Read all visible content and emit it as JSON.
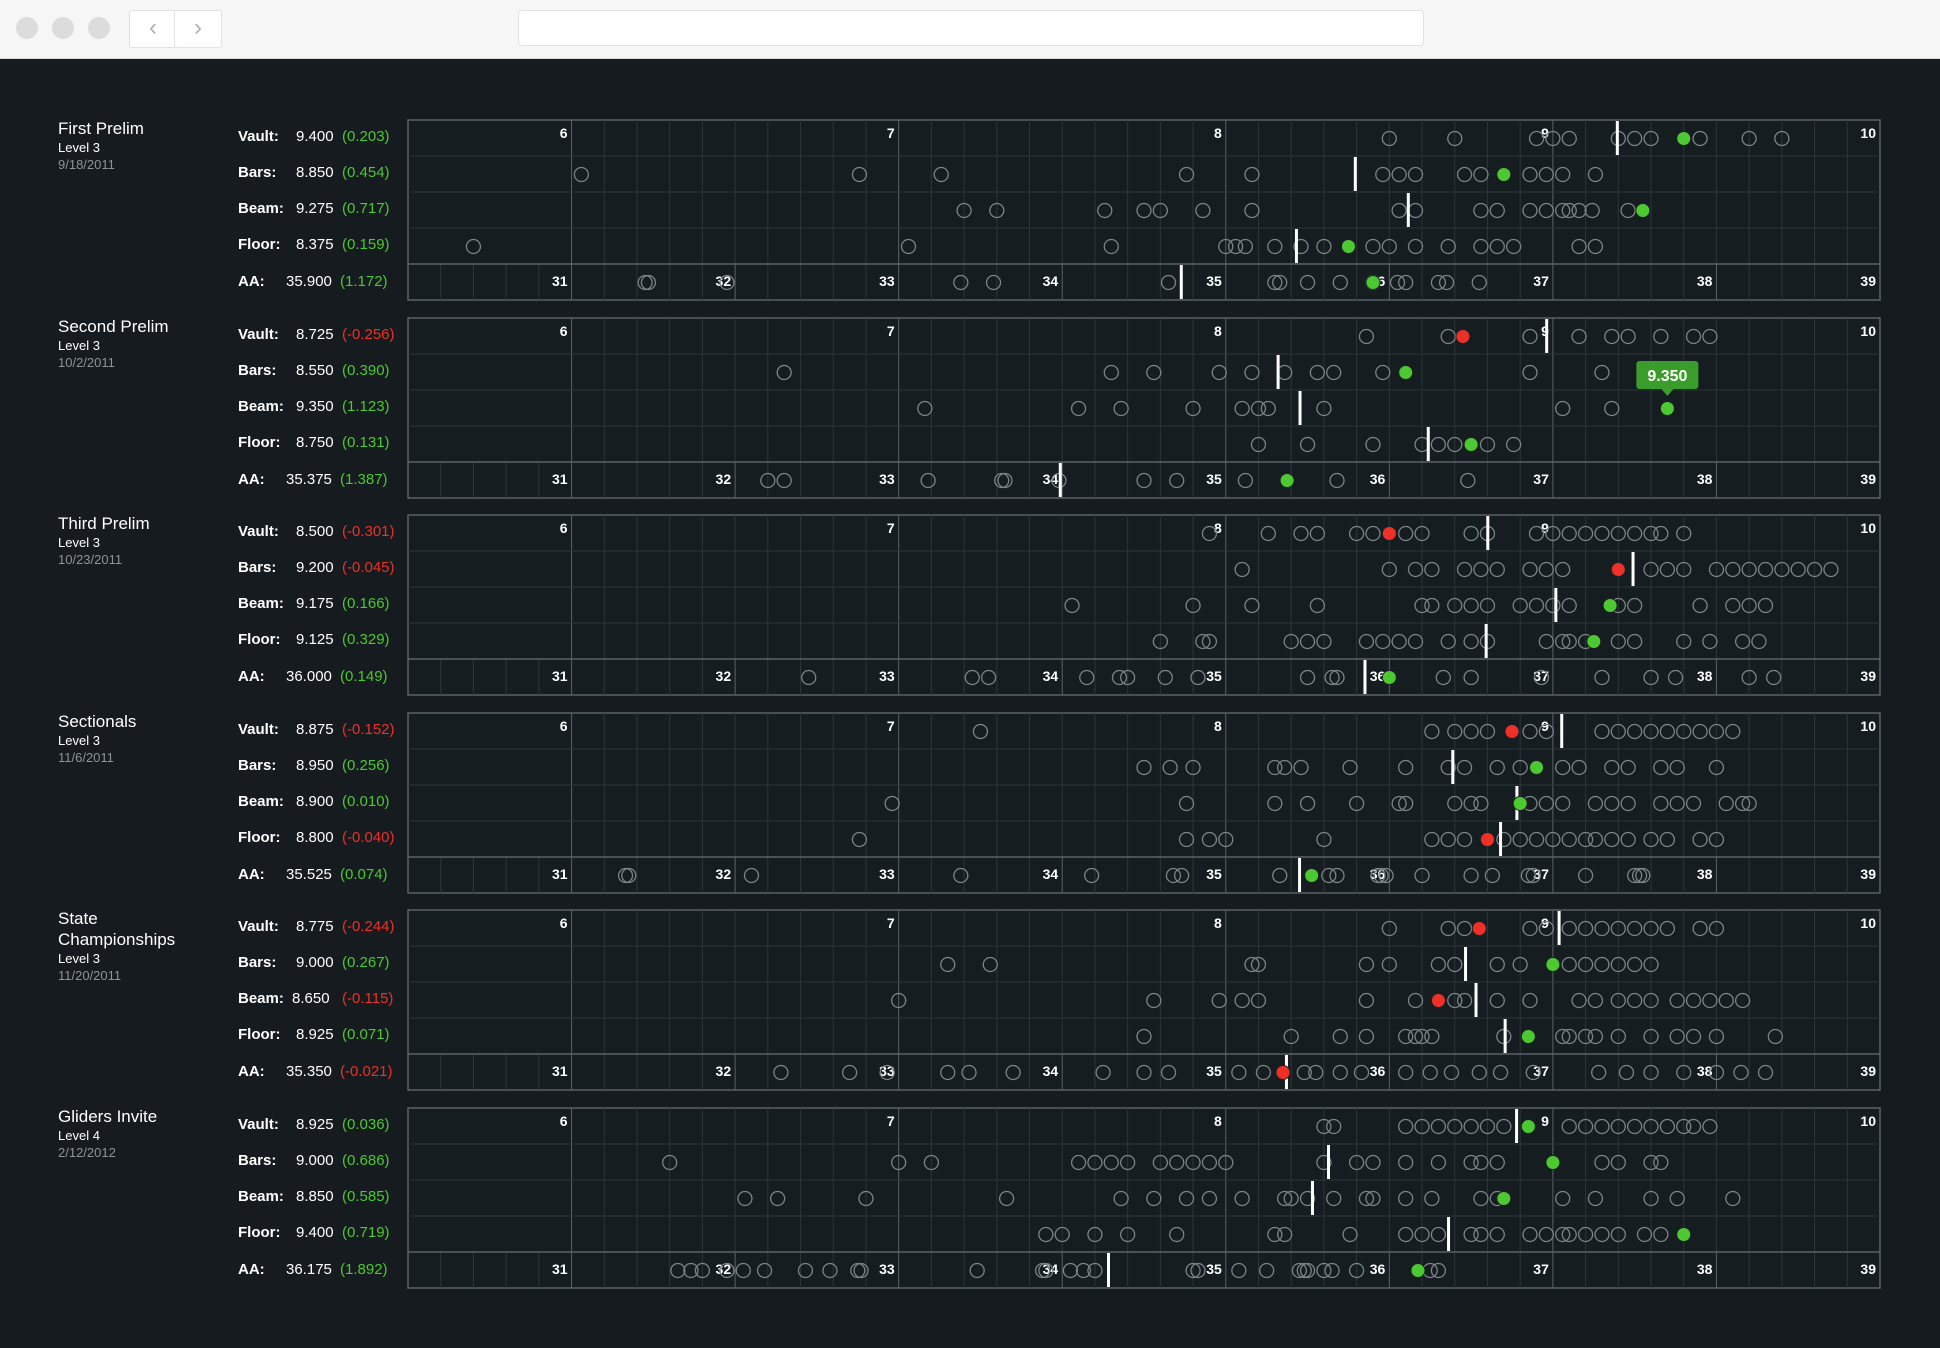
{
  "colors": {
    "background": "#151b1e",
    "grid": "#3b4246",
    "ring": "#7d8488",
    "positive": "#4cc831",
    "negative": "#ee3028",
    "text": "#ffffff",
    "date": "#8e9396",
    "tooltip": "#3a9c2b"
  },
  "chart_data": {
    "type": "scatter",
    "title": "",
    "events": [
      "Vault:",
      "Bars:",
      "Beam:",
      "Floor:",
      "AA:"
    ],
    "event_axis": {
      "min": 5.5,
      "max": 10,
      "ticks": [
        6,
        7,
        8,
        9,
        10
      ]
    },
    "aa_axis": {
      "min": 30,
      "max": 39,
      "ticks": [
        31,
        32,
        33,
        34,
        35,
        36,
        37,
        38,
        39
      ]
    },
    "tooltip": {
      "meet": 1,
      "row": 2,
      "text": "9.350"
    },
    "meets": [
      {
        "name": "First Prelim",
        "level": "Level 3",
        "date": "9/18/2011",
        "rows": [
          {
            "event": "Vault:",
            "score": "9.400",
            "diff": "(0.203)",
            "sign": "pos",
            "value": 9.4,
            "mean": 9.197,
            "field": [
              8.5,
              8.7,
              8.95,
              9.0,
              9.05,
              9.2,
              9.25,
              9.3,
              9.45,
              9.6,
              9.7
            ]
          },
          {
            "event": "Bars:",
            "score": "8.850",
            "diff": "(0.454)",
            "sign": "pos",
            "value": 8.85,
            "mean": 8.396,
            "field": [
              6.03,
              6.88,
              7.13,
              7.88,
              8.08,
              8.48,
              8.53,
              8.58,
              8.73,
              8.78,
              8.93,
              8.98,
              9.03,
              9.13
            ]
          },
          {
            "event": "Beam:",
            "score": "9.275",
            "diff": "(0.717)",
            "sign": "pos",
            "value": 9.275,
            "mean": 8.558,
            "field": [
              7.2,
              7.3,
              7.63,
              7.75,
              7.8,
              7.93,
              8.08,
              8.53,
              8.58,
              8.78,
              8.83,
              8.93,
              8.98,
              9.03,
              9.05,
              9.08,
              9.12,
              9.23
            ]
          },
          {
            "event": "Floor:",
            "score": "8.375",
            "diff": "(0.159)",
            "sign": "pos",
            "value": 8.375,
            "mean": 8.216,
            "field": [
              5.7,
              7.03,
              7.65,
              8.0,
              8.03,
              8.06,
              8.15,
              8.23,
              8.3,
              8.45,
              8.5,
              8.58,
              8.68,
              8.78,
              8.83,
              8.88,
              9.08,
              9.13
            ]
          },
          {
            "event": "AA:",
            "score": "35.900",
            "diff": "(1.172)",
            "sign": "pos",
            "value": 35.9,
            "mean": 34.728,
            "field": [
              31.45,
              31.47,
              31.95,
              33.38,
              33.58,
              34.65,
              35.3,
              35.33,
              35.5,
              35.7,
              35.9,
              36.05,
              36.1,
              36.3,
              36.35,
              36.55
            ]
          }
        ]
      },
      {
        "name": "Second Prelim",
        "level": "Level 3",
        "date": "10/2/2011",
        "rows": [
          {
            "event": "Vault:",
            "score": "8.725",
            "diff": "(-0.256)",
            "sign": "neg",
            "value": 8.725,
            "mean": 8.981,
            "field": [
              8.43,
              8.68,
              8.93,
              9.08,
              9.18,
              9.23,
              9.33,
              9.43,
              9.48
            ]
          },
          {
            "event": "Bars:",
            "score": "8.550",
            "diff": "(0.390)",
            "sign": "pos",
            "value": 8.55,
            "mean": 8.16,
            "field": [
              6.65,
              7.65,
              7.78,
              7.98,
              8.08,
              8.18,
              8.28,
              8.33,
              8.48,
              8.93,
              9.15
            ]
          },
          {
            "event": "Beam:",
            "score": "9.350",
            "diff": "(1.123)",
            "sign": "pos",
            "value": 9.35,
            "mean": 8.227,
            "field": [
              7.08,
              7.55,
              7.68,
              7.9,
              8.05,
              8.1,
              8.13,
              8.3,
              9.03,
              9.18
            ]
          },
          {
            "event": "Floor:",
            "score": "8.750",
            "diff": "(0.131)",
            "sign": "pos",
            "value": 8.75,
            "mean": 8.619,
            "field": [
              8.1,
              8.25,
              8.45,
              8.6,
              8.65,
              8.7,
              8.8,
              8.88
            ]
          },
          {
            "event": "AA:",
            "score": "35.375",
            "diff": "(1.387)",
            "sign": "pos",
            "value": 35.375,
            "mean": 33.988,
            "field": [
              32.2,
              32.3,
              33.18,
              33.63,
              33.65,
              33.98,
              34.5,
              34.7,
              35.12,
              35.68,
              36.48
            ]
          }
        ]
      },
      {
        "name": "Third Prelim",
        "level": "Level 3",
        "date": "10/23/2011",
        "rows": [
          {
            "event": "Vault:",
            "score": "8.500",
            "diff": "(-0.301)",
            "sign": "neg",
            "value": 8.5,
            "mean": 8.801,
            "field": [
              7.95,
              8.13,
              8.23,
              8.28,
              8.4,
              8.45,
              8.55,
              8.6,
              8.75,
              8.8,
              8.95,
              9.0,
              9.05,
              9.1,
              9.15,
              9.2,
              9.25,
              9.3,
              9.33,
              9.4
            ]
          },
          {
            "event": "Bars:",
            "score": "9.200",
            "diff": "(-0.045)",
            "sign": "neg",
            "value": 9.2,
            "mean": 9.245,
            "field": [
              8.05,
              8.5,
              8.58,
              8.63,
              8.73,
              8.78,
              8.83,
              8.93,
              8.98,
              9.03,
              9.3,
              9.35,
              9.4,
              9.5,
              9.55,
              9.6,
              9.65,
              9.7,
              9.75,
              9.8,
              9.85
            ]
          },
          {
            "event": "Beam:",
            "score": "9.175",
            "diff": "(0.166)",
            "sign": "pos",
            "value": 9.175,
            "mean": 9.009,
            "field": [
              7.53,
              7.9,
              8.08,
              8.28,
              8.6,
              8.63,
              8.7,
              8.75,
              8.8,
              8.9,
              8.95,
              9.0,
              9.05,
              9.2,
              9.25,
              9.45,
              9.55,
              9.6,
              9.65
            ]
          },
          {
            "event": "Floor:",
            "score": "9.125",
            "diff": "(0.329)",
            "sign": "pos",
            "value": 9.125,
            "mean": 8.796,
            "field": [
              7.8,
              7.93,
              7.95,
              8.2,
              8.25,
              8.3,
              8.43,
              8.48,
              8.53,
              8.58,
              8.68,
              8.75,
              8.8,
              8.98,
              9.03,
              9.05,
              9.1,
              9.2,
              9.25,
              9.4,
              9.48,
              9.58,
              9.63
            ]
          },
          {
            "event": "AA:",
            "score": "36.000",
            "diff": "(0.149)",
            "sign": "pos",
            "value": 36.0,
            "mean": 35.851,
            "field": [
              32.45,
              33.45,
              33.55,
              34.15,
              34.35,
              34.4,
              34.63,
              34.83,
              35.5,
              35.65,
              35.68,
              36.33,
              36.5,
              36.93,
              37.3,
              37.6,
              37.75,
              38.2,
              38.35
            ]
          }
        ]
      },
      {
        "name": "Sectionals",
        "level": "Level 3",
        "date": "11/6/2011",
        "rows": [
          {
            "event": "Vault:",
            "score": "8.875",
            "diff": "(-0.152)",
            "sign": "neg",
            "value": 8.875,
            "mean": 9.027,
            "field": [
              7.25,
              8.63,
              8.7,
              8.75,
              8.8,
              8.93,
              8.98,
              9.15,
              9.2,
              9.25,
              9.3,
              9.35,
              9.4,
              9.45,
              9.5,
              9.55
            ]
          },
          {
            "event": "Bars:",
            "score": "8.950",
            "diff": "(0.256)",
            "sign": "pos",
            "value": 8.95,
            "mean": 8.694,
            "field": [
              7.75,
              7.83,
              7.9,
              8.15,
              8.18,
              8.23,
              8.38,
              8.55,
              8.68,
              8.73,
              8.83,
              8.9,
              9.03,
              9.08,
              9.18,
              9.23,
              9.33,
              9.38,
              9.5
            ]
          },
          {
            "event": "Beam:",
            "score": "8.900",
            "diff": "(0.010)",
            "sign": "pos",
            "value": 8.9,
            "mean": 8.89,
            "field": [
              6.98,
              7.88,
              8.15,
              8.25,
              8.4,
              8.53,
              8.55,
              8.7,
              8.75,
              8.78,
              8.93,
              8.98,
              9.03,
              9.13,
              9.18,
              9.23,
              9.33,
              9.38,
              9.43,
              9.53,
              9.58,
              9.6
            ]
          },
          {
            "event": "Floor:",
            "score": "8.800",
            "diff": "(-0.040)",
            "sign": "neg",
            "value": 8.8,
            "mean": 8.84,
            "field": [
              6.88,
              7.88,
              7.95,
              8.0,
              8.3,
              8.63,
              8.68,
              8.73,
              8.85,
              8.9,
              8.95,
              9.0,
              9.05,
              9.1,
              9.13,
              9.18,
              9.23,
              9.3,
              9.35,
              9.45,
              9.5
            ]
          },
          {
            "event": "AA:",
            "score": "35.525",
            "diff": "(0.074)",
            "sign": "pos",
            "value": 35.525,
            "mean": 35.451,
            "field": [
              31.33,
              31.35,
              32.1,
              33.38,
              34.18,
              34.68,
              34.73,
              35.33,
              35.63,
              35.68,
              35.93,
              35.95,
              35.98,
              36.2,
              36.5,
              36.63,
              36.85,
              36.88,
              37.2,
              37.5,
              37.53,
              37.55
            ]
          }
        ]
      },
      {
        "name": "State Championships",
        "level": "Level 3",
        "date": "11/20/2011",
        "rows": [
          {
            "event": "Vault:",
            "score": "8.775",
            "diff": "(-0.244)",
            "sign": "neg",
            "value": 8.775,
            "mean": 9.019,
            "field": [
              8.5,
              8.68,
              8.73,
              8.93,
              8.98,
              9.05,
              9.1,
              9.15,
              9.2,
              9.25,
              9.3,
              9.35,
              9.45,
              9.5
            ]
          },
          {
            "event": "Bars:",
            "score": "9.000",
            "diff": "(0.267)",
            "sign": "pos",
            "value": 9.0,
            "mean": 8.733,
            "field": [
              7.15,
              7.28,
              8.08,
              8.1,
              8.43,
              8.5,
              8.65,
              8.7,
              8.83,
              8.9,
              9.05,
              9.1,
              9.15,
              9.2,
              9.25,
              9.3
            ]
          },
          {
            "event": "Beam:",
            "score": "8.650",
            "diff": "(-0.115)",
            "sign": "neg",
            "value": 8.65,
            "mean": 8.765,
            "field": [
              7.0,
              7.78,
              7.98,
              8.05,
              8.1,
              8.43,
              8.58,
              8.7,
              8.73,
              8.83,
              8.93,
              9.08,
              9.13,
              9.2,
              9.25,
              9.3,
              9.38,
              9.43,
              9.48,
              9.53,
              9.58
            ]
          },
          {
            "event": "Floor:",
            "score": "8.925",
            "diff": "(0.071)",
            "sign": "pos",
            "value": 8.925,
            "mean": 8.854,
            "field": [
              7.75,
              8.2,
              8.35,
              8.43,
              8.55,
              8.58,
              8.6,
              8.63,
              8.85,
              9.03,
              9.05,
              9.1,
              9.13,
              9.2,
              9.3,
              9.38,
              9.43,
              9.5,
              9.68
            ]
          },
          {
            "event": "AA:",
            "score": "35.350",
            "diff": "(-0.021)",
            "sign": "neg",
            "value": 35.35,
            "mean": 35.371,
            "field": [
              32.28,
              32.7,
              32.93,
              33.3,
              33.43,
              33.7,
              34.25,
              34.5,
              34.65,
              35.08,
              35.23,
              35.48,
              35.55,
              35.7,
              35.83,
              36.1,
              36.25,
              36.38,
              36.55,
              36.68,
              36.88,
              37.28,
              37.45,
              37.6,
              37.8,
              38.0,
              38.15,
              38.3
            ]
          }
        ]
      },
      {
        "name": "Gliders Invite",
        "level": "Level 4",
        "date": "2/12/2012",
        "rows": [
          {
            "event": "Vault:",
            "score": "8.925",
            "diff": "(0.036)",
            "sign": "pos",
            "value": 8.925,
            "mean": 8.889,
            "field": [
              8.3,
              8.33,
              8.55,
              8.6,
              8.65,
              8.7,
              8.75,
              8.8,
              8.85,
              9.05,
              9.1,
              9.15,
              9.2,
              9.25,
              9.3,
              9.35,
              9.4,
              9.43,
              9.48
            ]
          },
          {
            "event": "Bars:",
            "score": "9.000",
            "diff": "(0.686)",
            "sign": "pos",
            "value": 9.0,
            "mean": 8.314,
            "field": [
              6.3,
              7.0,
              7.1,
              7.55,
              7.6,
              7.65,
              7.7,
              7.8,
              7.85,
              7.9,
              7.95,
              8.0,
              8.3,
              8.4,
              8.45,
              8.55,
              8.65,
              8.75,
              8.78,
              8.83,
              9.15,
              9.2,
              9.3,
              9.33
            ]
          },
          {
            "event": "Beam:",
            "score": "8.850",
            "diff": "(0.585)",
            "sign": "pos",
            "value": 8.85,
            "mean": 8.265,
            "field": [
              6.53,
              6.63,
              6.9,
              7.33,
              7.68,
              7.78,
              7.88,
              7.95,
              8.05,
              8.18,
              8.2,
              8.25,
              8.33,
              8.43,
              8.45,
              8.55,
              8.63,
              8.78,
              8.83,
              9.03,
              9.13,
              9.3,
              9.38,
              9.55
            ]
          },
          {
            "event": "Floor:",
            "score": "9.400",
            "diff": "(0.719)",
            "sign": "pos",
            "value": 9.4,
            "mean": 8.681,
            "field": [
              7.45,
              7.5,
              7.6,
              7.7,
              7.85,
              8.15,
              8.18,
              8.38,
              8.55,
              8.6,
              8.65,
              8.75,
              8.78,
              8.83,
              8.93,
              8.98,
              9.03,
              9.05,
              9.1,
              9.15,
              9.2,
              9.28,
              9.33
            ]
          },
          {
            "event": "AA:",
            "score": "36.175",
            "diff": "(1.892)",
            "sign": "pos",
            "value": 36.175,
            "mean": 34.283,
            "field": [
              31.65,
              31.73,
              31.8,
              31.95,
              32.05,
              32.18,
              32.43,
              32.58,
              32.75,
              32.77,
              33.48,
              33.88,
              33.9,
              34.05,
              34.13,
              34.2,
              34.8,
              34.83,
              35.08,
              35.25,
              35.45,
              35.48,
              35.5,
              35.6,
              35.65,
              35.8,
              36.25,
              36.3
            ]
          }
        ]
      }
    ]
  }
}
